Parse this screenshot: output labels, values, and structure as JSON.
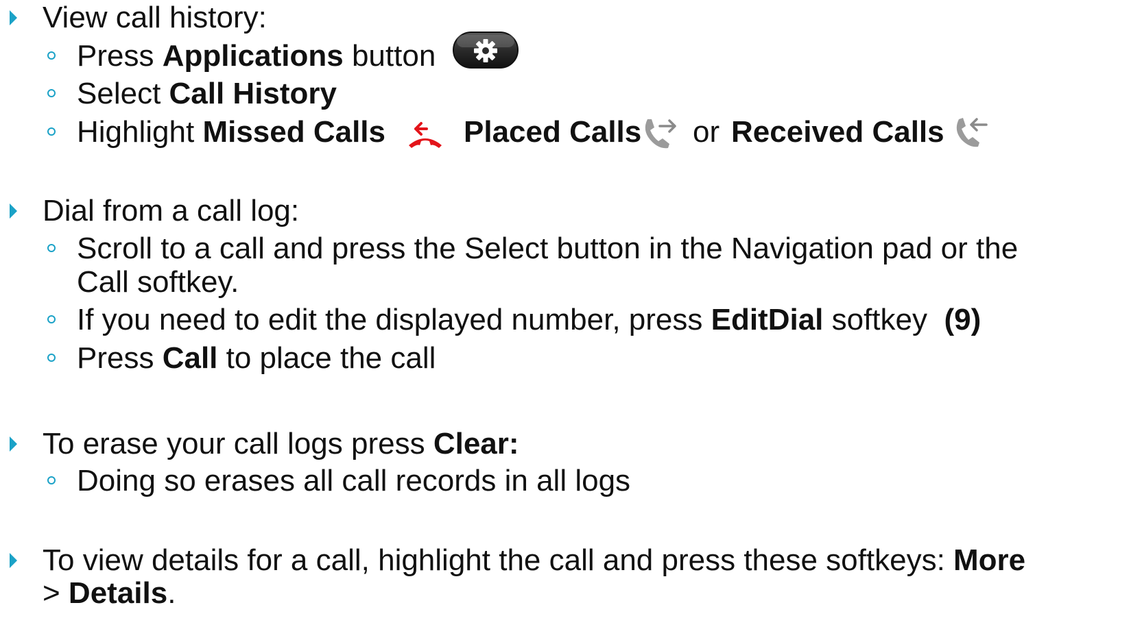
{
  "sections": [
    {
      "heading": "View call history:",
      "items": [
        {
          "pre": "Press ",
          "bold": "Applications",
          "post": " button"
        },
        {
          "pre": "Select ",
          "bold": "Call History",
          "post": ""
        },
        {
          "pre": "Highlight ",
          "missed": "Missed Calls",
          "placed": "Placed Calls",
          "or": "or",
          "received": "Received Calls"
        }
      ]
    },
    {
      "heading": "Dial from a call log:",
      "items": [
        {
          "line1": "Scroll to a call and press the Select button in the Navigation pad or the",
          "line2": "Call softkey."
        },
        {
          "pre": "If you need to edit the displayed number, press ",
          "bold": "EditDial",
          "post": " softkey  ",
          "bold2": "(9)"
        },
        {
          "pre": "Press ",
          "bold": "Call",
          "post": " to place the call"
        }
      ]
    },
    {
      "heading_pre": "To erase your call logs press ",
      "heading_bold": "Clear:",
      "items": [
        {
          "text": "Doing so erases all call records in all logs"
        }
      ]
    },
    {
      "line1_pre": "To view details for a call, highlight the call and press these softkeys: ",
      "line1_bold": "More",
      "line2_pre": "> ",
      "line2_bold": "Details",
      "line2_post": "."
    }
  ],
  "icons": {
    "applications": "gear-icon",
    "missed": "missed-call-icon",
    "placed": "placed-call-icon",
    "received": "received-call-icon"
  },
  "colors": {
    "bullet": "#1ba2c7",
    "missed_icon": "#e3141a",
    "call_icons": "#8a8a8a",
    "app_button": "#2b2b2b"
  }
}
